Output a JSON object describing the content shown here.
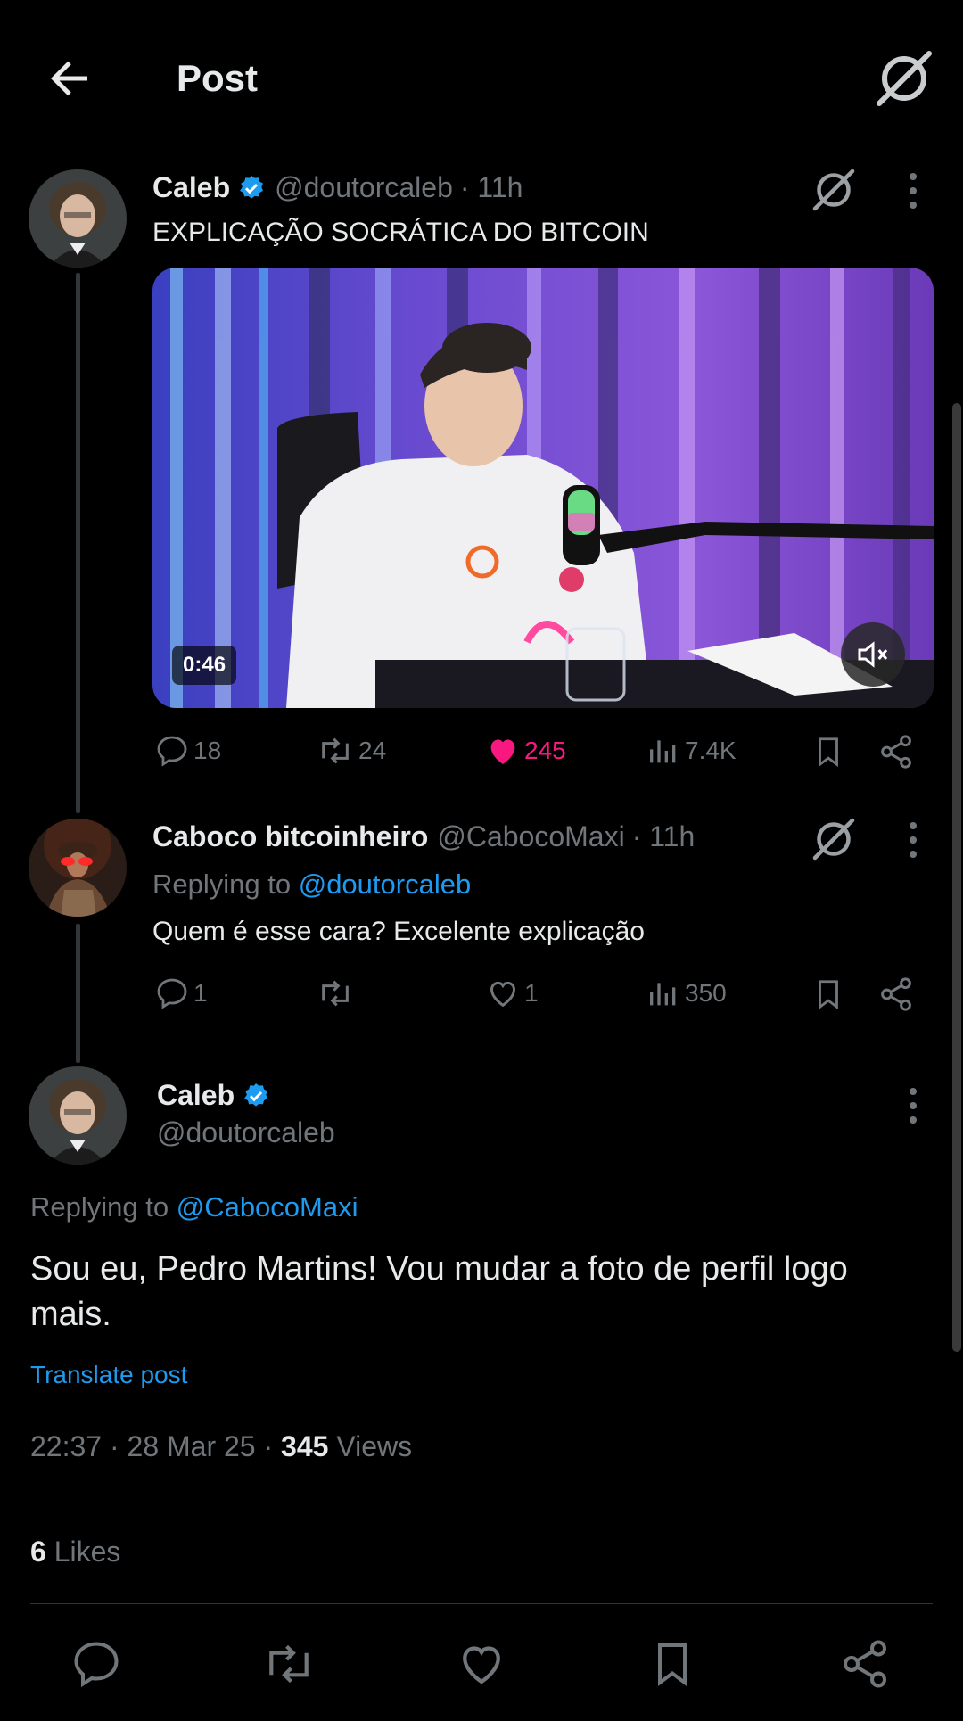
{
  "header": {
    "title": "Post",
    "back_icon": "arrow-left-icon",
    "grok_icon": "grok-icon"
  },
  "tweet1": {
    "name": "Caleb",
    "handle": "@doutorcaleb",
    "time": "· 11h",
    "verified": true,
    "text": "EXPLICAÇÃO SOCRÁTICA DO BITCOIN",
    "video_duration": "0:46",
    "actions": {
      "replies": "18",
      "reposts": "24",
      "likes": "245",
      "views": "7.4K"
    }
  },
  "tweet2": {
    "name": "Caboco bitcoinheiro",
    "handle": "@CabocoMaxi",
    "time": "· 11h",
    "replying_prefix": "Replying to",
    "replying_to": "@doutorcaleb",
    "text": "Quem é esse cara? Excelente explicação",
    "actions": {
      "replies": "1",
      "reposts": "",
      "likes": "1",
      "views": "350"
    }
  },
  "main": {
    "name": "Caleb",
    "handle": "@doutorcaleb",
    "verified": true,
    "replying_prefix": "Replying to",
    "replying_to": "@CabocoMaxi",
    "text": "Sou eu, Pedro Martins! Vou mudar a foto de perfil logo mais.",
    "translate": "Translate post",
    "timestamp": "22:37 · 28 Mar 25 ·",
    "views_count": "345",
    "views_label": "Views",
    "likes_count": "6",
    "likes_label": "Likes"
  },
  "colors": {
    "background": "#000000",
    "text": "#e7e9ea",
    "muted": "#71767b",
    "accent": "#1d9bf0",
    "like": "#f91880",
    "border": "#2f3336"
  }
}
